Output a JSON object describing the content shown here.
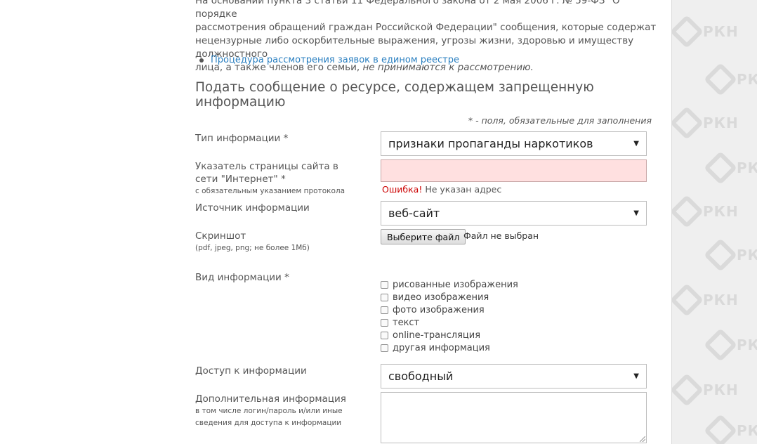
{
  "intro": {
    "line1": "На основании пункта 3 статьи 11 Федерального закона от 2 мая 2006 г. № 59-ФЗ \"О порядке",
    "line2": "рассмотрения обращений граждан Российской Федерации\" сообщения, которые содержат",
    "line3": "нецензурные либо оскорбительные выражения, угрозы жизни, здоровью и имуществу должностного",
    "line4_plain": "лица, а также членов его семьи,",
    "line4_italic": "не принимаются к рассмотрению."
  },
  "bullet_link": "Процедура рассмотрения заявок в едином реестре",
  "section_title": "Подать сообщение о ресурсе, содержащем запрещенную информацию",
  "required_note": "* - поля, обязательные для заполнения",
  "watermark": "РКН",
  "form": {
    "info_type": {
      "label": "Тип информации *",
      "value": "признаки пропаганды наркотиков"
    },
    "url": {
      "label": "Указатель страницы сайта в сети \"Интернет\" *",
      "hint": "с обязательным указанием протокола",
      "value": "",
      "error_word": "Ошибка!",
      "error_text": " Не указан адрес"
    },
    "source": {
      "label": "Источник информации",
      "value": "веб-сайт"
    },
    "screenshot": {
      "label": "Скриншот",
      "hint": "(pdf, jpeg, png; не более 1Мб)",
      "button": "Выберите файл",
      "status": "Файл не выбран"
    },
    "kind": {
      "label": "Вид информации *",
      "options": [
        {
          "label": "рисованные изображения",
          "checked": false
        },
        {
          "label": "видео изображения",
          "checked": false
        },
        {
          "label": "фото изображения",
          "checked": false
        },
        {
          "label": "текст",
          "checked": false
        },
        {
          "label": "online-трансляция",
          "checked": false
        },
        {
          "label": "другая информация",
          "checked": false
        }
      ]
    },
    "access": {
      "label": "Доступ к информации",
      "value": "свободный"
    },
    "extra": {
      "label": "Дополнительная информация",
      "hint1": "в том числе логин/пароль и/или иные",
      "hint2": "сведения для доступа к информации",
      "value": ""
    }
  },
  "icons": {
    "dropdown": "chevron-down-icon",
    "watermark": "rkn-logo-icon"
  }
}
